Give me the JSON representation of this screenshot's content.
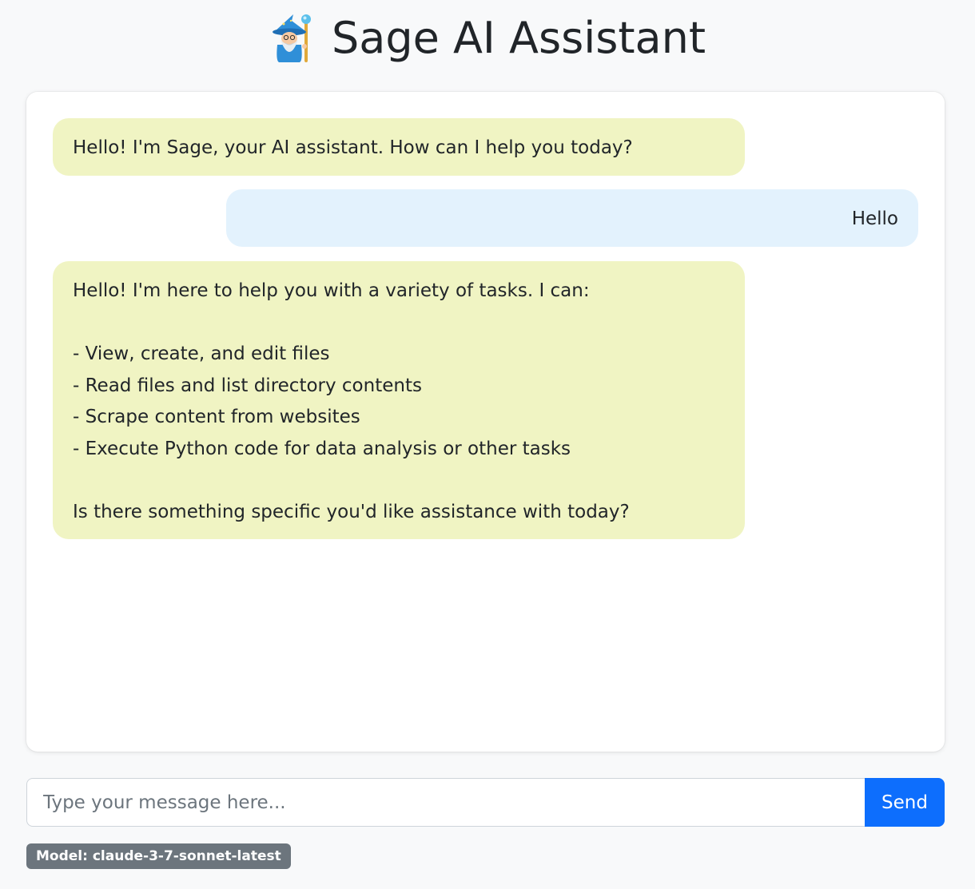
{
  "header": {
    "icon": "wizard-icon",
    "title": "Sage AI Assistant"
  },
  "chat": {
    "messages": [
      {
        "role": "assistant",
        "text": "Hello! I'm Sage, your AI assistant. How can I help you today?"
      },
      {
        "role": "user",
        "text": "Hello"
      },
      {
        "role": "assistant",
        "text": "Hello! I'm here to help you with a variety of tasks. I can:\n\n- View, create, and edit files\n- Read files and list directory contents\n- Scrape content from websites\n- Execute Python code for data analysis or other tasks\n\nIs there something specific you'd like assistance with today?"
      }
    ]
  },
  "composer": {
    "placeholder": "Type your message here...",
    "value": "",
    "send_label": "Send"
  },
  "status": {
    "model_label": "Model: claude-3-7-sonnet-latest"
  },
  "colors": {
    "assistant_bubble": "#f0f4c3",
    "user_bubble": "#e3f2fd",
    "send_button": "#0d6efd",
    "badge": "#6c757d"
  }
}
